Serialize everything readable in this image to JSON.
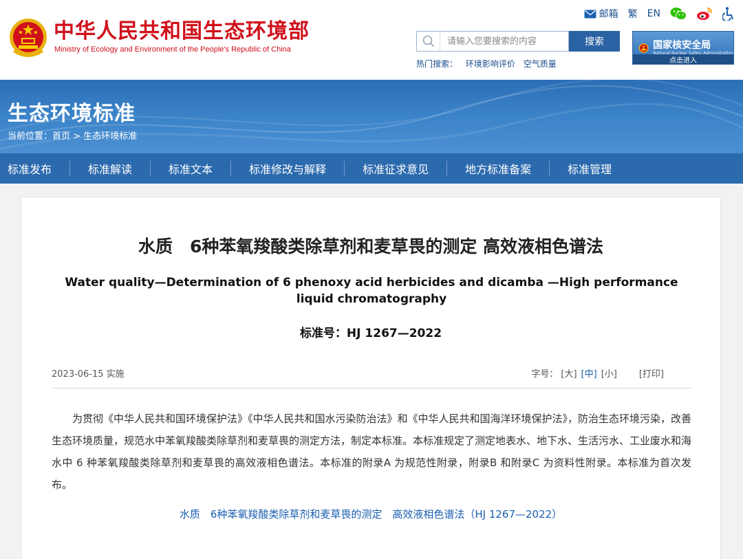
{
  "header": {
    "logo_cn": "中华人民共和国生态环境部",
    "logo_en": "Ministry of Ecology and Environment of the People's Republic of China",
    "toplinks": {
      "mail": "邮箱",
      "traditional": "繁",
      "english": "EN"
    },
    "search": {
      "placeholder": "请输入您要搜索的内容",
      "button": "搜索"
    },
    "hot_search": {
      "label": "热门搜索：",
      "items": [
        "环境影响评价",
        "空气质量"
      ]
    },
    "nnsa": {
      "name_cn": "国家核安全局",
      "name_en": "National Nuclear Safety Administration",
      "enter": "点击进入"
    }
  },
  "banner": {
    "title": "生态环境标准",
    "breadcrumb": {
      "prefix": "当前位置：",
      "home": "首页",
      "sep": " > ",
      "current": "生态环境标准"
    }
  },
  "nav": {
    "items": [
      "标准发布",
      "标准解读",
      "标准文本",
      "标准修改与解释",
      "标准征求意见",
      "地方标准备案",
      "标准管理"
    ]
  },
  "article": {
    "title_cn": "水质　6种苯氧羧酸类除草剂和麦草畏的测定 高效液相色谱法",
    "title_en": "Water quality—Determination of 6 phenoxy acid herbicides and dicamba —High performance liquid chromatography",
    "standard_no": "标准号：HJ 1267—2022",
    "date": "2023-06-15 实施",
    "font_size": {
      "label": "字号：",
      "large": "[大]",
      "medium": "[中]",
      "small": "[小]"
    },
    "print": "[打印]",
    "body": "为贯彻《中华人民共和国环境保护法》《中华人民共和国水污染防治法》和《中华人民共和国海洋环境保护法》，防治生态环境污染，改善生态环境质量，规范水中苯氧羧酸类除草剂和麦草畏的测定方法，制定本标准。本标准规定了测定地表水、地下水、生活污水、工业废水和海水中 6 种苯氧羧酸类除草剂和麦草畏的高效液相色谱法。本标准的附录A 为规范性附录，附录B 和附录C 为资料性附录。本标准为首次发布。",
    "attachment": "水质　6种苯氧羧酸类除草剂和麦草畏的测定　高效液相色谱法（HJ 1267—2022）"
  },
  "colors": {
    "brand_red": "#d0101b",
    "nav_blue": "#2c6aae",
    "link_blue": "#1a5fb0",
    "wechat_green": "#2dc100",
    "weibo_red": "#e6162d"
  }
}
